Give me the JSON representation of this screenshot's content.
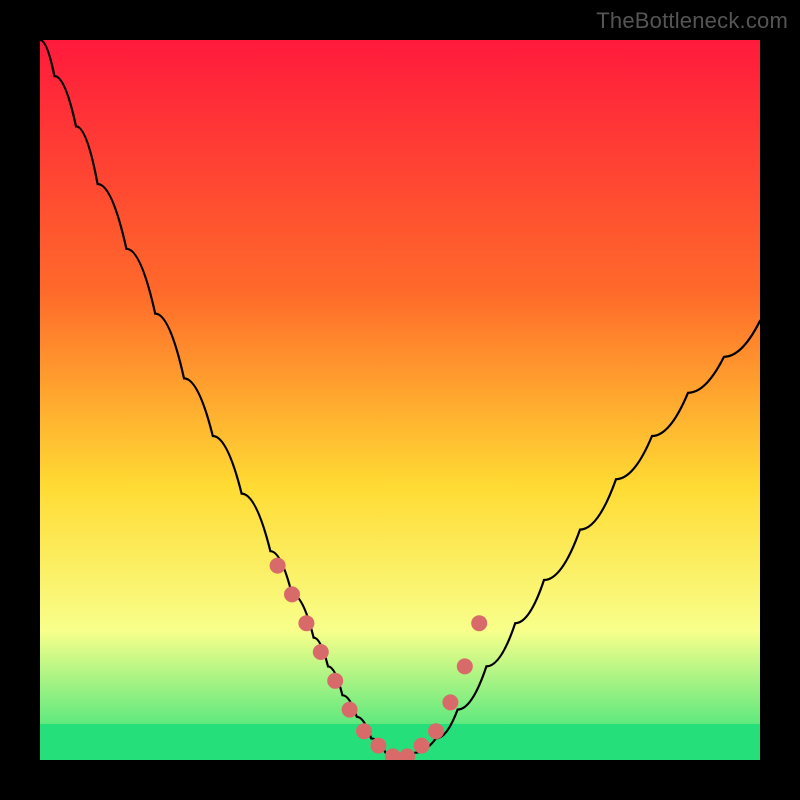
{
  "watermark": "TheBottleneck.com",
  "colors": {
    "page_bg": "#000000",
    "gradient_top": "#ff1a3c",
    "gradient_mid_upper": "#ff6a2a",
    "gradient_mid": "#ffdb33",
    "gradient_lower": "#f8ff8a",
    "gradient_bottom": "#25e07a",
    "curve_stroke": "#000000",
    "marker_fill": "#d86a6a",
    "marker_stroke": "#6a2f2f"
  },
  "chart_data": {
    "type": "line",
    "title": "",
    "xlabel": "",
    "ylabel": "",
    "xlim": [
      0,
      100
    ],
    "ylim": [
      0,
      100
    ],
    "grid": false,
    "series": [
      {
        "name": "bottleneck-curve",
        "x": [
          0,
          2,
          5,
          8,
          12,
          16,
          20,
          24,
          28,
          32,
          35,
          38,
          40,
          42,
          44,
          46,
          48,
          50,
          52,
          55,
          58,
          62,
          66,
          70,
          75,
          80,
          85,
          90,
          95,
          100
        ],
        "y": [
          100,
          95,
          88,
          80,
          71,
          62,
          53,
          45,
          37,
          29,
          23,
          17,
          13,
          9,
          6,
          3,
          1,
          0,
          1,
          3,
          7,
          13,
          19,
          25,
          32,
          39,
          45,
          51,
          56,
          61
        ]
      }
    ],
    "markers": {
      "name": "highlighted-points",
      "x": [
        33,
        35,
        37,
        39,
        41,
        43,
        45,
        47,
        49,
        50,
        51,
        53,
        55,
        57,
        59,
        61
      ],
      "y": [
        27,
        23,
        19,
        15,
        11,
        7,
        4,
        2,
        0.5,
        0,
        0.5,
        2,
        4,
        8,
        13,
        19
      ]
    },
    "bottom_band": {
      "y_from": 0,
      "y_to": 5,
      "color": "#25e07a"
    }
  }
}
